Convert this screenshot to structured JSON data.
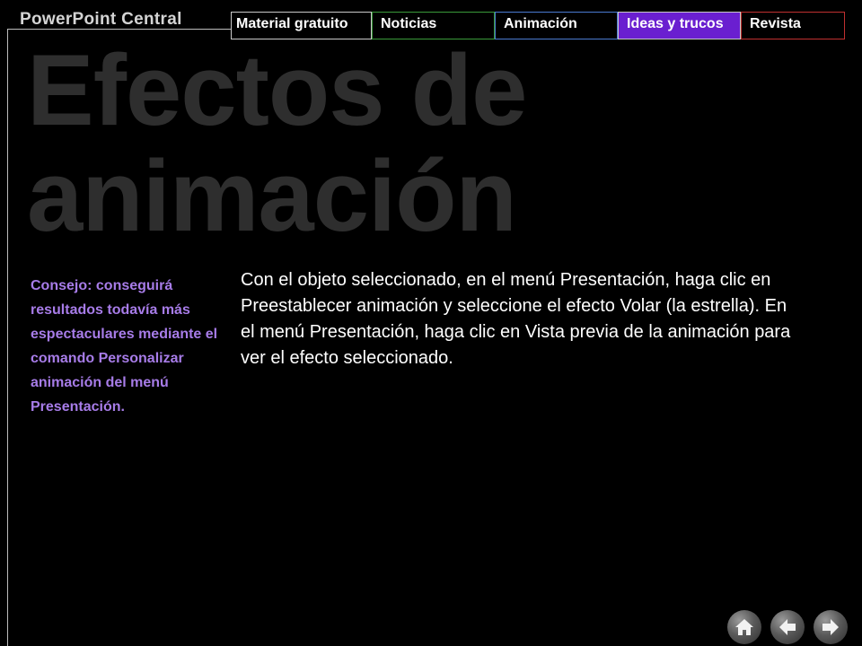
{
  "brand": "PowerPoint Central",
  "nav": {
    "tabs": [
      {
        "label": "Material gratuito"
      },
      {
        "label": "Noticias"
      },
      {
        "label": "Animación"
      },
      {
        "label": "Ideas y trucos"
      },
      {
        "label": "Revista"
      }
    ],
    "active_tab": "Ideas y trucos"
  },
  "page": {
    "title_line1": "Efectos de",
    "title_line2": "animación",
    "tip_text": "Consejo: conseguirá resultados todavía más espectaculares mediante el comando Personalizar animación del menú Presentación.",
    "body_text": "Con el objeto seleccionado, en el menú Presentación, haga clic en Preestablecer animación y seleccione el efecto Volar (la estrella). En el menú Presentación, haga clic en Vista previa de la animación para ver el efecto seleccionado."
  },
  "colors": {
    "background": "#000000",
    "active_tab": "#6a1fd0",
    "tip_text": "#a77ce8",
    "title_watermark": "#2e2e2e"
  },
  "footer": {
    "icons": [
      "home-icon",
      "back-arrow-icon",
      "forward-arrow-icon"
    ]
  }
}
